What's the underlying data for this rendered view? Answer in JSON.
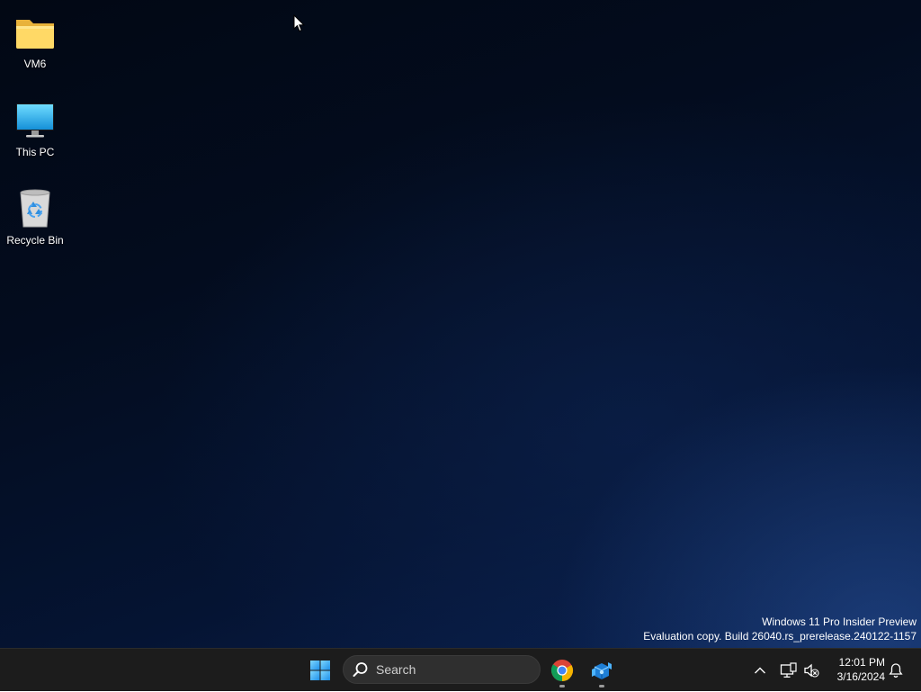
{
  "desktop": {
    "icons": [
      {
        "label": "VM6",
        "icon": "folder-icon"
      },
      {
        "label": "This PC",
        "icon": "monitor-icon"
      },
      {
        "label": "Recycle Bin",
        "icon": "recycle-bin-icon"
      }
    ],
    "watermark": {
      "line1": "Windows 11 Pro Insider Preview",
      "line2": "Evaluation copy. Build 26040.rs_prerelease.240122-1157"
    }
  },
  "taskbar": {
    "search": {
      "label": "Search"
    },
    "apps": [
      {
        "name": "Google Chrome",
        "icon": "chrome-icon",
        "running": true
      },
      {
        "name": "App",
        "icon": "app-icon",
        "running": true
      }
    ],
    "clock": {
      "time": "12:01 PM",
      "date": "3/16/2024"
    }
  },
  "colors": {
    "taskbar_bg": "#1c1c1c",
    "accent": "#0a84ff",
    "wallpaper_dark": "#020814",
    "wallpaper_light": "#0a2252"
  }
}
